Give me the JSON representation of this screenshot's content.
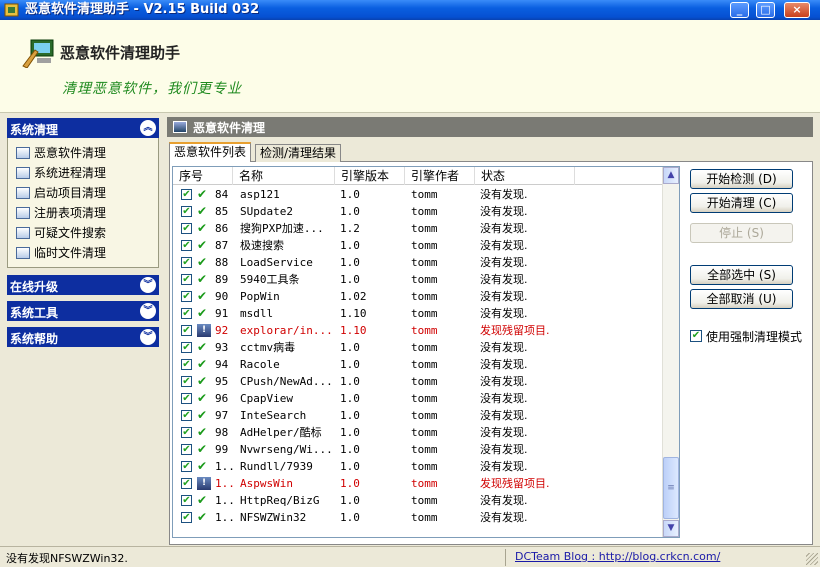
{
  "window": {
    "title": "恶意软件清理助手 - V2.15 Build 032",
    "minimize": "_",
    "maximize": "□",
    "close": "×"
  },
  "header": {
    "title": "恶意软件清理助手",
    "slogan": "清理恶意软件，我们更专业"
  },
  "sidebar": {
    "groups": [
      {
        "label": "系统清理",
        "chevron": "︽"
      },
      {
        "label": "在线升级",
        "chevron": "︾"
      },
      {
        "label": "系统工具",
        "chevron": "︾"
      },
      {
        "label": "系统帮助",
        "chevron": "︾"
      }
    ],
    "items": [
      {
        "label": "恶意软件清理",
        "icon": "malware-clean-icon"
      },
      {
        "label": "系统进程清理",
        "icon": "process-icon"
      },
      {
        "label": "启动项目清理",
        "icon": "startup-icon"
      },
      {
        "label": "注册表项清理",
        "icon": "registry-icon"
      },
      {
        "label": "可疑文件搜索",
        "icon": "file-search-icon"
      },
      {
        "label": "临时文件清理",
        "icon": "temp-file-icon"
      }
    ]
  },
  "panel": {
    "title": "恶意软件清理",
    "tabs": [
      "恶意软件列表",
      "检测/清理结果"
    ],
    "columns": [
      "序号",
      "名称",
      "引擎版本",
      "引擎作者",
      "状态"
    ]
  },
  "rows": [
    {
      "num": "84",
      "name": "asp121",
      "ver": "1.0",
      "author": "tomm",
      "status": "没有发现.",
      "warn": false
    },
    {
      "num": "85",
      "name": "SUpdate2",
      "ver": "1.0",
      "author": "tomm",
      "status": "没有发现.",
      "warn": false
    },
    {
      "num": "86",
      "name": "搜狗PXP加速...",
      "ver": "1.2",
      "author": "tomm",
      "status": "没有发现.",
      "warn": false
    },
    {
      "num": "87",
      "name": "极速搜索",
      "ver": "1.0",
      "author": "tomm",
      "status": "没有发现.",
      "warn": false
    },
    {
      "num": "88",
      "name": "LoadService",
      "ver": "1.0",
      "author": "tomm",
      "status": "没有发现.",
      "warn": false
    },
    {
      "num": "89",
      "name": "5940工具条",
      "ver": "1.0",
      "author": "tomm",
      "status": "没有发现.",
      "warn": false
    },
    {
      "num": "90",
      "name": "PopWin",
      "ver": "1.02",
      "author": "tomm",
      "status": "没有发现.",
      "warn": false
    },
    {
      "num": "91",
      "name": "msdll",
      "ver": "1.10",
      "author": "tomm",
      "status": "没有发现.",
      "warn": false
    },
    {
      "num": "92",
      "name": "explorar/in...",
      "ver": "1.10",
      "author": "tomm",
      "status": "发现残留项目.",
      "warn": true
    },
    {
      "num": "93",
      "name": "cctmv病毒",
      "ver": "1.0",
      "author": "tomm",
      "status": "没有发现.",
      "warn": false
    },
    {
      "num": "94",
      "name": "Racole",
      "ver": "1.0",
      "author": "tomm",
      "status": "没有发现.",
      "warn": false
    },
    {
      "num": "95",
      "name": "CPush/NewAd...",
      "ver": "1.0",
      "author": "tomm",
      "status": "没有发现.",
      "warn": false
    },
    {
      "num": "96",
      "name": "CpapView",
      "ver": "1.0",
      "author": "tomm",
      "status": "没有发现.",
      "warn": false
    },
    {
      "num": "97",
      "name": "InteSearch",
      "ver": "1.0",
      "author": "tomm",
      "status": "没有发现.",
      "warn": false
    },
    {
      "num": "98",
      "name": "AdHelper/酷标",
      "ver": "1.0",
      "author": "tomm",
      "status": "没有发现.",
      "warn": false
    },
    {
      "num": "99",
      "name": "Nvwrseng/Wi...",
      "ver": "1.0",
      "author": "tomm",
      "status": "没有发现.",
      "warn": false
    },
    {
      "num": "1..",
      "name": "Rundll/7939",
      "ver": "1.0",
      "author": "tomm",
      "status": "没有发现.",
      "warn": false
    },
    {
      "num": "1..",
      "name": "AspwsWin",
      "ver": "1.0",
      "author": "tomm",
      "status": "发现残留项目.",
      "warn": true
    },
    {
      "num": "1..",
      "name": "HttpReq/BizG",
      "ver": "1.0",
      "author": "tomm",
      "status": "没有发现.",
      "warn": false
    },
    {
      "num": "1..",
      "name": "NFSWZWin32",
      "ver": "1.0",
      "author": "tomm",
      "status": "没有发现.",
      "warn": false
    }
  ],
  "scrollbar": {
    "up": "▲",
    "down": "▼",
    "grip": "≡"
  },
  "buttons": {
    "start_detect": "开始检测 (D)",
    "start_clean": "开始清理 (C)",
    "stop": "停止 (S)",
    "select_all": "全部选中 (S)",
    "deselect_all": "全部取消 (U)"
  },
  "options": {
    "strict_mode": "使用强制清理模式",
    "check": "✔"
  },
  "statusbar": {
    "message": "没有发现NFSWZWin32.",
    "link": "DCTeam Blog : http://blog.crkcn.com/"
  },
  "colors": {
    "title_blue": "#0650d2",
    "group_blue": "#0d2ea0",
    "warn_red": "#d00000",
    "ok_green": "#1a9a1a"
  }
}
